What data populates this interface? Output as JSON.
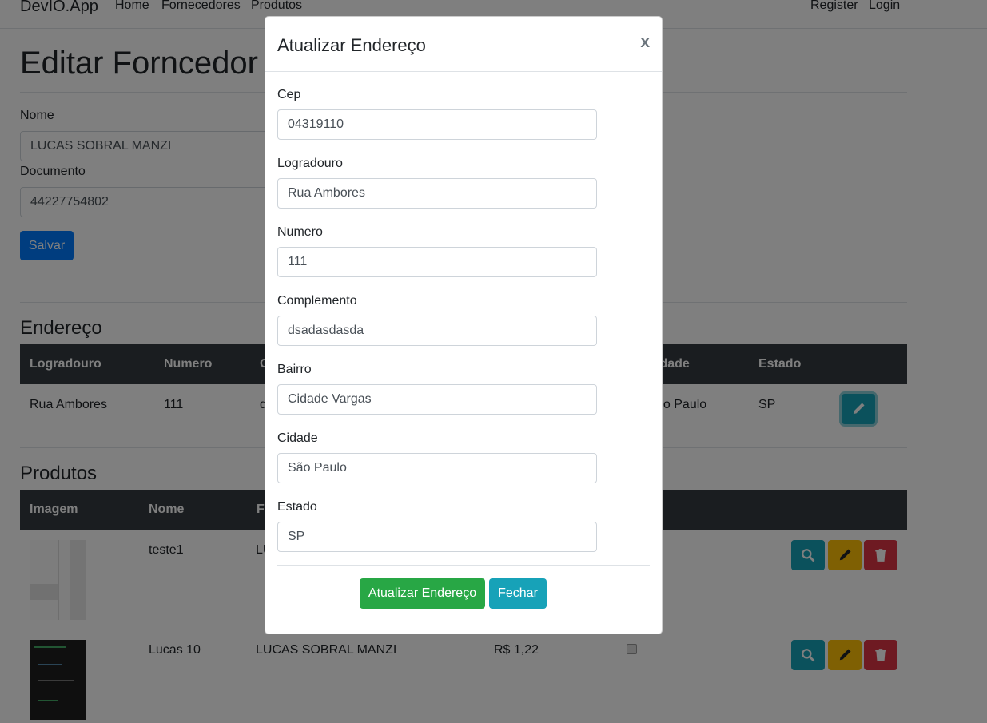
{
  "navbar": {
    "brand": "DevIO.App",
    "links": [
      "Home",
      "Fornecedores",
      "Produtos"
    ],
    "right_links": [
      "Register",
      "Login"
    ]
  },
  "page": {
    "title": "Editar Forncedor",
    "nome_label": "Nome",
    "nome_value": "LUCAS SOBRAL MANZI",
    "documento_label": "Documento",
    "documento_value": "44227754802",
    "save_label": "Salvar"
  },
  "endereco": {
    "heading": "Endereço",
    "headers": [
      "Logradouro",
      "Numero",
      "C",
      "idade",
      "Estado"
    ],
    "row": {
      "logradouro": "Rua Ambores",
      "numero": "111",
      "complemento": "d",
      "cidade": "ão Paulo",
      "estado": "SP"
    }
  },
  "produtos": {
    "heading": "Produtos",
    "headers": [
      "Imagem",
      "Nome",
      "Fo",
      ""
    ],
    "rows": [
      {
        "nome": "teste1",
        "fornecedor": "LU",
        "valor": ""
      },
      {
        "nome": "Lucas 10",
        "fornecedor": "LUCAS SOBRAL MANZI",
        "valor": "R$ 1,22"
      }
    ]
  },
  "modal": {
    "title": "Atualizar Endereço",
    "close": "x",
    "fields": [
      {
        "label": "Cep",
        "value": "04319110"
      },
      {
        "label": "Logradouro",
        "value": "Rua Ambores"
      },
      {
        "label": "Numero",
        "value": "111"
      },
      {
        "label": "Complemento",
        "value": "dsadasdasda"
      },
      {
        "label": "Bairro",
        "value": "Cidade Vargas"
      },
      {
        "label": "Cidade",
        "value": "São Paulo"
      },
      {
        "label": "Estado",
        "value": "SP"
      }
    ],
    "submit_label": "Atualizar Endereço",
    "close_label": "Fechar"
  },
  "colors": {
    "primary": "#007bff",
    "info": "#17a2b8",
    "warning": "#ffc107",
    "danger": "#dc3545",
    "success": "#28a745",
    "dark": "#343a40"
  }
}
